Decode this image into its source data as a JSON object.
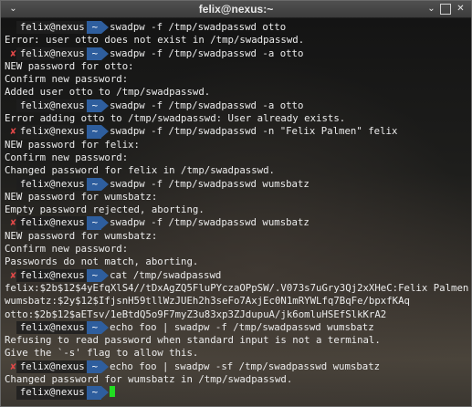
{
  "window": {
    "title": "felix@nexus:~",
    "minimize_glyph": "⌄",
    "maximize_glyph": "",
    "close_glyph": "✕"
  },
  "colors": {
    "error_mark": "#e04848",
    "dir_segment": "#2e5e9e",
    "cursor": "#22dd22"
  },
  "terminal": {
    "prompt": {
      "user": "felix@nexus",
      "dir": "~",
      "error_mark": "✘"
    },
    "lines": [
      {
        "kind": "prompt",
        "error": false,
        "cmd": "swadpw -f /tmp/swadpasswd otto"
      },
      {
        "kind": "out",
        "text": "Error: user otto does not exist in /tmp/swadpasswd."
      },
      {
        "kind": "prompt",
        "error": true,
        "cmd": "swadpw -f /tmp/swadpasswd -a otto"
      },
      {
        "kind": "out",
        "text": "NEW password for otto:"
      },
      {
        "kind": "out",
        "text": "Confirm new password:"
      },
      {
        "kind": "out",
        "text": "Added user otto to /tmp/swadpasswd."
      },
      {
        "kind": "prompt",
        "error": false,
        "cmd": "swadpw -f /tmp/swadpasswd -a otto"
      },
      {
        "kind": "out",
        "text": "Error adding otto to /tmp/swadpasswd: User already exists."
      },
      {
        "kind": "prompt",
        "error": true,
        "cmd": "swadpw -f /tmp/swadpasswd -n \"Felix Palmen\" felix"
      },
      {
        "kind": "out",
        "text": "NEW password for felix:"
      },
      {
        "kind": "out",
        "text": "Confirm new password:"
      },
      {
        "kind": "out",
        "text": "Changed password for felix in /tmp/swadpasswd."
      },
      {
        "kind": "prompt",
        "error": false,
        "cmd": "swadpw -f /tmp/swadpasswd wumsbatz"
      },
      {
        "kind": "out",
        "text": "NEW password for wumsbatz:"
      },
      {
        "kind": "out",
        "text": "Empty password rejected, aborting."
      },
      {
        "kind": "prompt",
        "error": true,
        "cmd": "swadpw -f /tmp/swadpasswd wumsbatz"
      },
      {
        "kind": "out",
        "text": "NEW password for wumsbatz:"
      },
      {
        "kind": "out",
        "text": "Confirm new password:"
      },
      {
        "kind": "out",
        "text": "Passwords do not match, aborting."
      },
      {
        "kind": "prompt",
        "error": true,
        "cmd": "cat /tmp/swadpasswd"
      },
      {
        "kind": "out",
        "text": "felix:$2b$12$4yEfqXlS4//tDxAgZQ5FluPYczaOPpSW/.V073s7uGry3Qj2xXHeC:Felix Palmen"
      },
      {
        "kind": "out",
        "text": "wumsbatz:$2y$12$IfjsnH59tllWzJUEh2h3seFo7AxjEc0N1mRYWLfq7BqFe/bpxfKAq"
      },
      {
        "kind": "out",
        "text": "otto:$2b$12$aETsv/1eBtdQ5o9F7myZ3u83xp3ZJdupuA/jk6omluHSEfSlkKrA2"
      },
      {
        "kind": "prompt",
        "error": false,
        "cmd": "echo foo | swadpw -f /tmp/swadpasswd wumsbatz"
      },
      {
        "kind": "out",
        "text": "Refusing to read password when standard input is not a terminal."
      },
      {
        "kind": "out",
        "text": "Give the `-s' flag to allow this."
      },
      {
        "kind": "prompt",
        "error": true,
        "cmd": "echo foo | swadpw -sf /tmp/swadpasswd wumsbatz"
      },
      {
        "kind": "out",
        "text": "Changed password for wumsbatz in /tmp/swadpasswd."
      },
      {
        "kind": "prompt",
        "error": false,
        "cmd": "",
        "cursor": true
      }
    ]
  }
}
